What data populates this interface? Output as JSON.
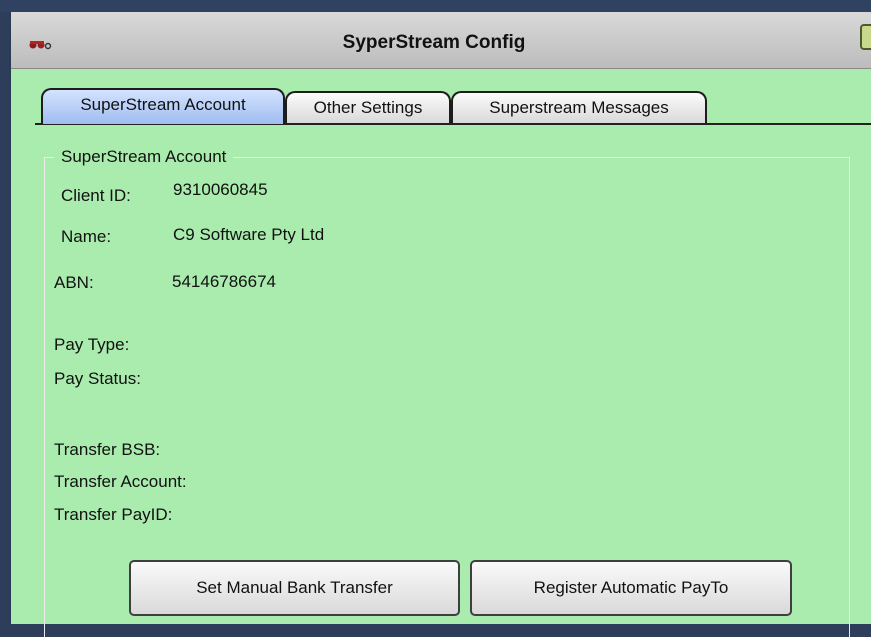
{
  "window": {
    "title": "SyperStream Config"
  },
  "tabs": [
    {
      "label": "SuperStream Account",
      "active": true
    },
    {
      "label": "Other Settings",
      "active": false
    },
    {
      "label": "Superstream Messages",
      "active": false
    }
  ],
  "account": {
    "group_title": "SuperStream Account",
    "client_id_label": "Client ID:",
    "client_id": "9310060845",
    "name_label": "Name:",
    "name": "C9 Software Pty Ltd",
    "abn_label": "ABN:",
    "abn": "54146786674",
    "pay_type_label": "Pay Type:",
    "pay_status_label": "Pay Status:",
    "transfer_bsb_label": "Transfer BSB:",
    "transfer_account_label": "Transfer Account:",
    "transfer_payid_label": "Transfer PayID:"
  },
  "buttons": {
    "manual_label": "Set Manual Bank Transfer",
    "payto_label": "Register Automatic PayTo"
  },
  "colors": {
    "panel_bg": "#a9ecad",
    "active_tab": "#9fbdf0",
    "desktop": "#2e3e5a"
  },
  "icons": {
    "app_icon": "app-logo-icon"
  }
}
